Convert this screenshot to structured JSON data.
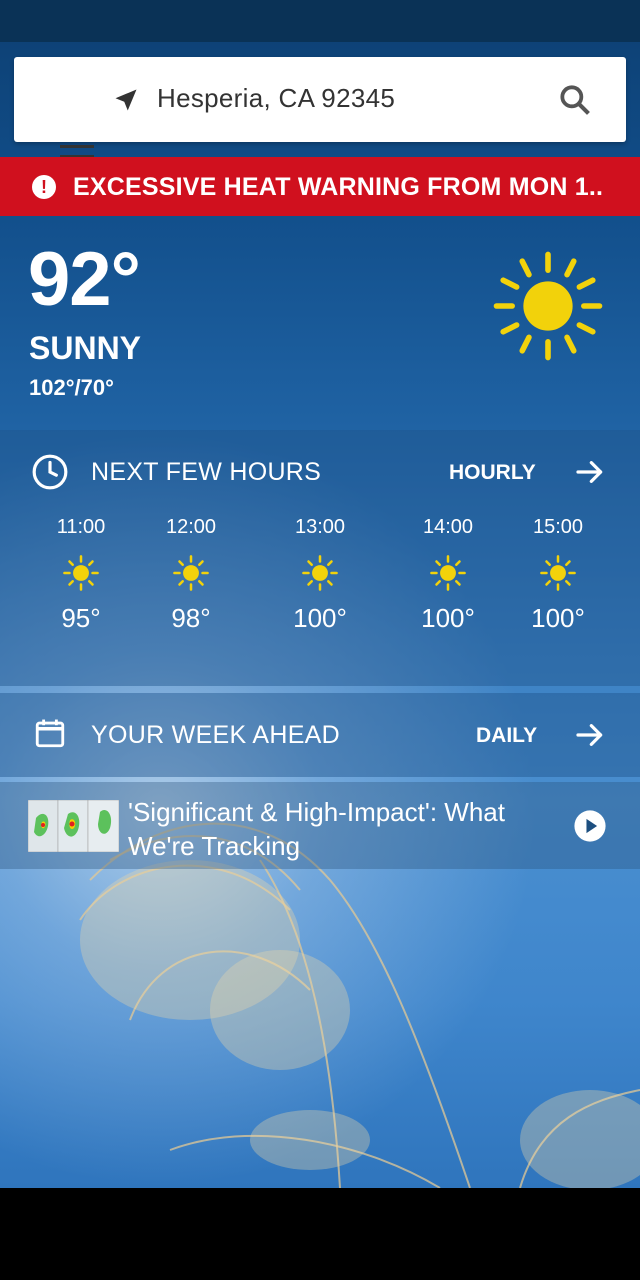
{
  "search": {
    "location": "Hesperia, CA 92345"
  },
  "alert": {
    "text": "EXCESSIVE HEAT WARNING FROM MON 1.."
  },
  "current": {
    "temperature": "92°",
    "condition": "SUNNY",
    "hi_lo": "102°/70°",
    "icon": "sun-icon"
  },
  "hourly": {
    "title": "NEXT FEW HOURS",
    "link": "HOURLY",
    "items": [
      {
        "time": "11:00",
        "temp": "95°",
        "icon": "sun-icon"
      },
      {
        "time": "12:00",
        "temp": "98°",
        "icon": "sun-icon"
      },
      {
        "time": "13:00",
        "temp": "100°",
        "icon": "sun-icon"
      },
      {
        "time": "14:00",
        "temp": "100°",
        "icon": "sun-icon"
      },
      {
        "time": "15:00",
        "temp": "100°",
        "icon": "sun-icon"
      }
    ]
  },
  "week": {
    "title": "YOUR WEEK AHEAD",
    "link": "DAILY"
  },
  "news": {
    "headline": "'Significant & High-Impact': What We're Tracking",
    "icon": "play-icon"
  },
  "colors": {
    "alert": "#d0101e",
    "sun": "#f2d20b"
  }
}
